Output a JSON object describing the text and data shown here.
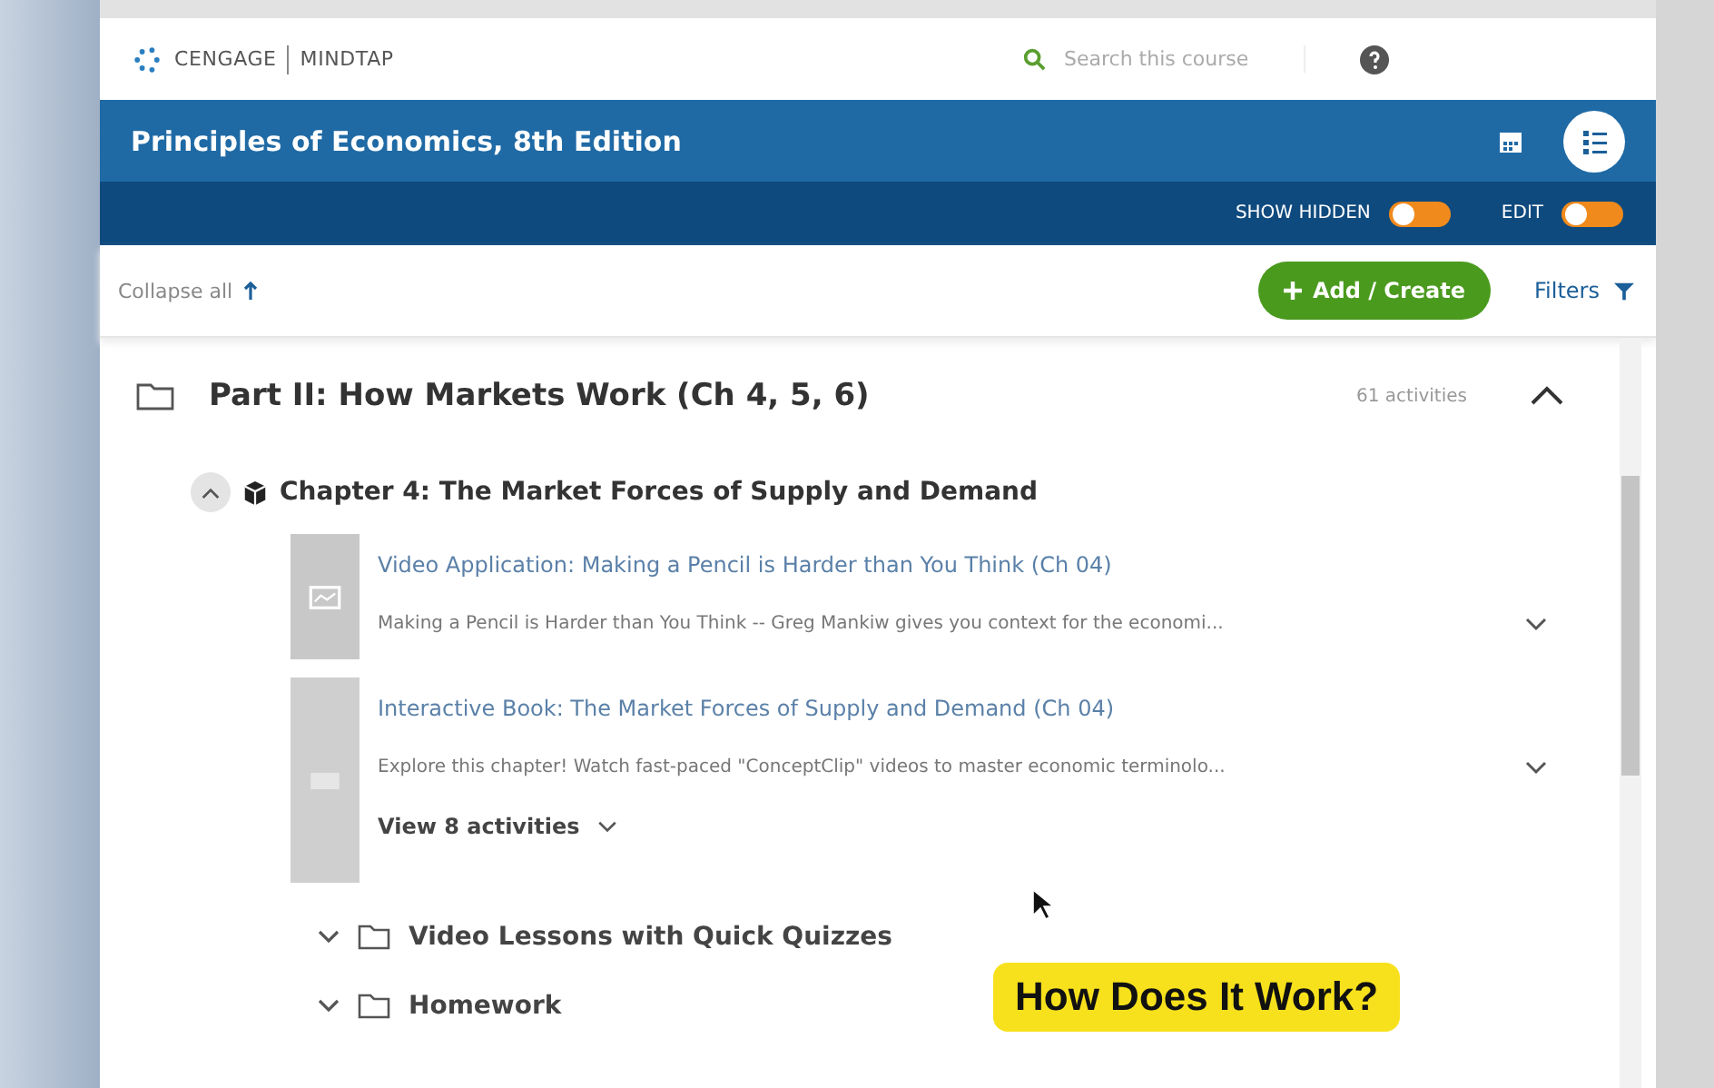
{
  "header": {
    "brand": "CENGAGE",
    "product": "MINDTAP",
    "search": {
      "placeholder": "Search this course"
    }
  },
  "course": {
    "title": "Principles of Economics, 8th Edition"
  },
  "toggles": [
    {
      "label": "SHOW HIDDEN",
      "on": false
    },
    {
      "label": "EDIT",
      "on": false
    }
  ],
  "toolbar": {
    "collapse": "Collapse all",
    "add": "Add / Create",
    "filters": "Filters"
  },
  "part": {
    "title": "Part II: How Markets Work (Ch 4, 5, 6)",
    "count": "61 activities",
    "expanded": true
  },
  "chapter": {
    "title": "Chapter 4: The Market Forces of Supply and Demand",
    "expanded": true
  },
  "activities": [
    {
      "kind": "video",
      "title": "Video Application: Making a Pencil is Harder than You Think (Ch 04)",
      "description": "Making a Pencil is Harder than You Think -- Greg Mankiw gives you context for the economi..."
    },
    {
      "kind": "book",
      "title": "Interactive Book: The Market Forces of Supply and Demand (Ch 04)",
      "description": "Explore this chapter! Watch fast-paced \"ConceptClip\" videos to master economic terminolo...",
      "more": "View 8 activities"
    }
  ],
  "folders": [
    {
      "title": "Video Lessons with Quick Quizzes",
      "expanded": false
    },
    {
      "title": "Homework",
      "expanded": false
    }
  ],
  "caption": "How Does It Work?"
}
